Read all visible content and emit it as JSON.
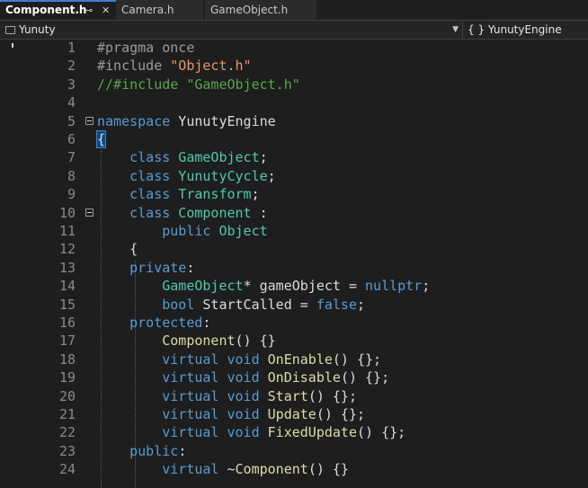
{
  "tabs": [
    {
      "label": "Component.h",
      "pin": "⊸",
      "close": "✕"
    },
    {
      "label": "Camera.h"
    },
    {
      "label": "GameObject.h"
    }
  ],
  "nav": {
    "scope": "Yunuty",
    "member": "{ } YunutyEngine"
  },
  "colors": {
    "preprocessor": "#9b9b9b",
    "string": "#e6966c",
    "comment": "#57a64a",
    "keyword": "#569cd6",
    "type": "#4ec9b0",
    "function": "#dcdcaa",
    "text": "#dcdcdc"
  },
  "lines": [
    {
      "n": "1",
      "tokens": [
        {
          "t": "#pragma once",
          "c": "pre"
        }
      ]
    },
    {
      "n": "2",
      "tokens": [
        {
          "t": "#include ",
          "c": "pre"
        },
        {
          "t": "\"Object.h\"",
          "c": "str"
        }
      ]
    },
    {
      "n": "3",
      "tokens": [
        {
          "t": "//#include \"GameObject.h\"",
          "c": "cmt"
        }
      ]
    },
    {
      "n": "4",
      "tokens": []
    },
    {
      "n": "5",
      "fold": true,
      "tokens": [
        {
          "t": "namespace",
          "c": "kw"
        },
        {
          "t": " YunutyEngine",
          "c": "pl"
        }
      ]
    },
    {
      "n": "6",
      "tokens": [
        {
          "t": "{",
          "c": "brace"
        }
      ]
    },
    {
      "n": "7",
      "tokens": [
        {
          "t": "    class",
          "c": "kw"
        },
        {
          "t": " GameObject",
          "c": "ty"
        },
        {
          "t": ";",
          "c": "pl"
        }
      ]
    },
    {
      "n": "8",
      "tokens": [
        {
          "t": "    class",
          "c": "kw"
        },
        {
          "t": " YunutyCycle",
          "c": "ty"
        },
        {
          "t": ";",
          "c": "pl"
        }
      ]
    },
    {
      "n": "9",
      "tokens": [
        {
          "t": "    class",
          "c": "kw"
        },
        {
          "t": " Transform",
          "c": "ty"
        },
        {
          "t": ";",
          "c": "pl"
        }
      ]
    },
    {
      "n": "10",
      "fold": true,
      "tokens": [
        {
          "t": "    class",
          "c": "kw"
        },
        {
          "t": " Component",
          "c": "ty"
        },
        {
          "t": " :",
          "c": "pl"
        }
      ]
    },
    {
      "n": "11",
      "tokens": [
        {
          "t": "        public",
          "c": "kw"
        },
        {
          "t": " Object",
          "c": "ty"
        }
      ]
    },
    {
      "n": "12",
      "tokens": [
        {
          "t": "    {",
          "c": "pl"
        }
      ]
    },
    {
      "n": "13",
      "tokens": [
        {
          "t": "    private",
          "c": "kw"
        },
        {
          "t": ":",
          "c": "pl"
        }
      ]
    },
    {
      "n": "14",
      "tokens": [
        {
          "t": "        GameObject",
          "c": "ty"
        },
        {
          "t": "* gameObject = ",
          "c": "pl"
        },
        {
          "t": "nullptr",
          "c": "kw"
        },
        {
          "t": ";",
          "c": "pl"
        }
      ]
    },
    {
      "n": "15",
      "tokens": [
        {
          "t": "        bool",
          "c": "kw"
        },
        {
          "t": " StartCalled = ",
          "c": "pl"
        },
        {
          "t": "false",
          "c": "kw"
        },
        {
          "t": ";",
          "c": "pl"
        }
      ]
    },
    {
      "n": "16",
      "tokens": [
        {
          "t": "    protected",
          "c": "kw"
        },
        {
          "t": ":",
          "c": "pl"
        }
      ]
    },
    {
      "n": "17",
      "tokens": [
        {
          "t": "        Component",
          "c": "fn"
        },
        {
          "t": "() {}",
          "c": "pl"
        }
      ]
    },
    {
      "n": "18",
      "tokens": [
        {
          "t": "        virtual",
          "c": "kw"
        },
        {
          "t": " void",
          "c": "kw"
        },
        {
          "t": " OnEnable",
          "c": "fn"
        },
        {
          "t": "() {};",
          "c": "pl"
        }
      ]
    },
    {
      "n": "19",
      "tokens": [
        {
          "t": "        virtual",
          "c": "kw"
        },
        {
          "t": " void",
          "c": "kw"
        },
        {
          "t": " OnDisable",
          "c": "fn"
        },
        {
          "t": "() {};",
          "c": "pl"
        }
      ]
    },
    {
      "n": "20",
      "tokens": [
        {
          "t": "        virtual",
          "c": "kw"
        },
        {
          "t": " void",
          "c": "kw"
        },
        {
          "t": " Start",
          "c": "fn"
        },
        {
          "t": "() {};",
          "c": "pl"
        }
      ]
    },
    {
      "n": "21",
      "tokens": [
        {
          "t": "        virtual",
          "c": "kw"
        },
        {
          "t": " void",
          "c": "kw"
        },
        {
          "t": " Update",
          "c": "fn"
        },
        {
          "t": "() {};",
          "c": "pl"
        }
      ]
    },
    {
      "n": "22",
      "tokens": [
        {
          "t": "        virtual",
          "c": "kw"
        },
        {
          "t": " void",
          "c": "kw"
        },
        {
          "t": " FixedUpdate",
          "c": "fn"
        },
        {
          "t": "() {};",
          "c": "pl"
        }
      ]
    },
    {
      "n": "23",
      "tokens": [
        {
          "t": "    public",
          "c": "kw"
        },
        {
          "t": ":",
          "c": "pl"
        }
      ]
    },
    {
      "n": "24",
      "tokens": [
        {
          "t": "        virtual",
          "c": "kw"
        },
        {
          "t": " ~",
          "c": "pl"
        },
        {
          "t": "Component",
          "c": "fn"
        },
        {
          "t": "() {}",
          "c": "pl"
        }
      ]
    }
  ]
}
